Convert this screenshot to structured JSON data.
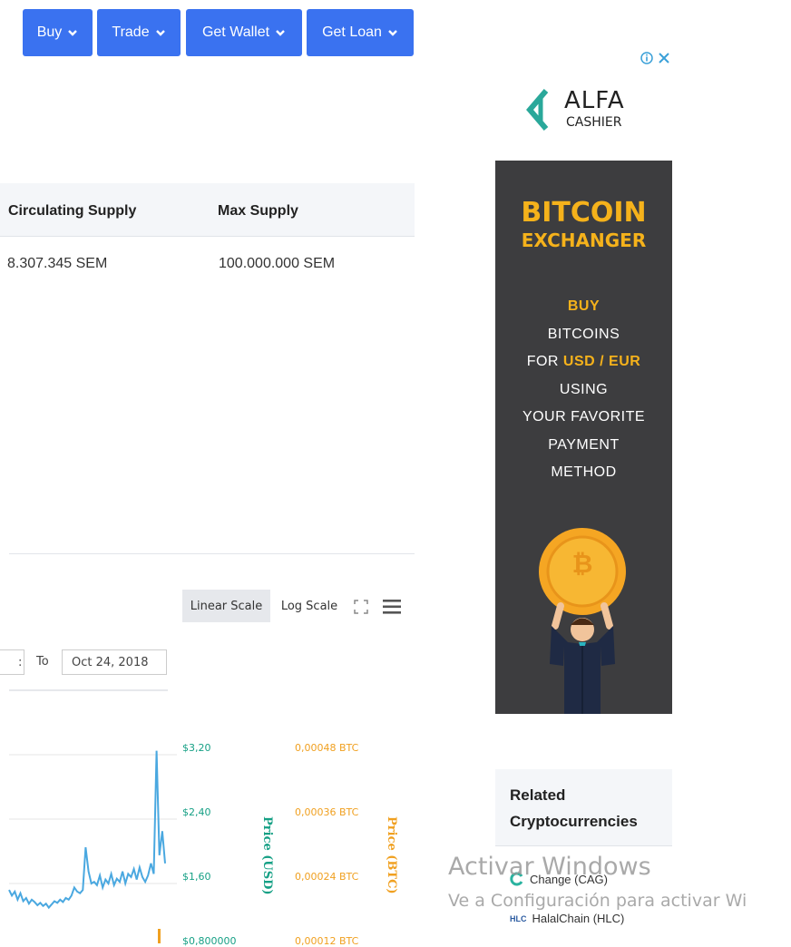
{
  "nav": {
    "buy": "Buy",
    "trade": "Trade",
    "wallet": "Get Wallet",
    "loan": "Get Loan"
  },
  "supply": {
    "headers": [
      "Circulating Supply",
      "Max Supply"
    ],
    "circulating": "8.307.345 SEM",
    "max": "100.000.000 SEM"
  },
  "chart_toolbar": {
    "linear": "Linear Scale",
    "log": "Log Scale",
    "date_from_partial": ":",
    "to_label": "To",
    "date_to": "Oct 24, 2018"
  },
  "chart_data": {
    "type": "line",
    "usd_ticks": [
      "$3,20",
      "$2,40",
      "$1,60",
      "$0,800000"
    ],
    "btc_ticks": [
      "0,00048 BTC",
      "0,00036 BTC",
      "0,00024 BTC",
      "0,00012 BTC"
    ],
    "usd_axis_title": "Price (USD)",
    "btc_axis_title": "Price (BTC)",
    "series": [
      {
        "color": "#4aa8e0",
        "values": [
          1.52,
          1.45,
          1.5,
          1.4,
          1.48,
          1.38,
          1.42,
          1.35,
          1.4,
          1.37,
          1.33,
          1.36,
          1.32,
          1.35,
          1.3,
          1.34,
          1.38,
          1.36,
          1.4,
          1.37,
          1.42,
          1.4,
          1.45,
          1.55,
          1.5,
          1.48,
          1.52,
          2.05,
          1.75,
          1.6,
          1.62,
          1.58,
          1.7,
          1.55,
          1.65,
          1.6,
          1.72,
          1.58,
          1.66,
          1.62,
          1.75,
          1.6,
          1.72,
          1.68,
          1.78,
          1.65,
          1.8,
          1.68,
          1.62,
          1.7,
          1.85,
          1.72,
          3.25,
          1.95,
          2.25,
          1.85
        ]
      }
    ],
    "ylim": [
      0.8,
      3.2
    ]
  },
  "ad": {
    "brand_main": "ALFA",
    "brand_sub": "CASHIER",
    "title1": "BITCOIN",
    "title2": "EXCHANGER",
    "lines": [
      "BUY",
      "BITCOINS",
      "FOR ",
      "USD / EUR",
      "USING",
      "YOUR FAVORITE",
      "PAYMENT",
      "METHOD"
    ],
    "coin_glyph": "₿"
  },
  "related": {
    "title_line1": "Related",
    "title_line2": "Cryptocurrencies",
    "items": [
      "Change (CAG)",
      "HalalChain (HLC)"
    ],
    "hlc_logo": "HLC"
  },
  "watermark": {
    "line1": "Activar Windows",
    "line2": "Ve a Configuración para activar Wi"
  },
  "colors": {
    "nav": "#3a72f0",
    "usd": "#16a085",
    "btc": "#f0a020",
    "line": "#4aa8e0"
  }
}
